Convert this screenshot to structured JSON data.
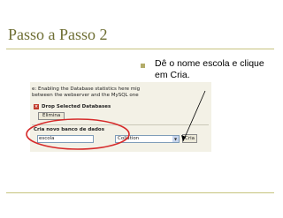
{
  "slide": {
    "title": "Passo a Passo 2",
    "bullet": "Dê o nome escola e clique em Cria."
  },
  "screenshot": {
    "warning_line1": "e: Enabling the Database statistics here mig",
    "warning_line2": "between the webserver and the MySQL one",
    "drop_label": "Drop Selected Databases",
    "elimina_label": "Elimina",
    "create_label": "Cria novo banco de dados",
    "name_value": "escola",
    "collation_value": "Collation",
    "cria_label": "Cria"
  },
  "colors": {
    "title": "#6e6e33",
    "rule": "#c6c37e",
    "highlight_ellipse": "#d62a2a"
  }
}
